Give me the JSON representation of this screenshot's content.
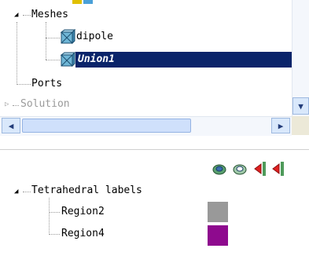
{
  "tree": {
    "meshes_label": "Meshes",
    "dipole_label": "dipole",
    "union_label": "Union1",
    "ports_label": "Ports",
    "solution_label": "Solution"
  },
  "icons": {
    "mesh": "mesh-cube-icon",
    "expanded": "triangle-down-icon",
    "collapsed": "triangle-right-icon"
  },
  "toolbar": {
    "buttons": [
      "mesh-show-icon",
      "mesh-hide-icon",
      "arrow-left-red-icon",
      "arrow-left-red-icon-2"
    ]
  },
  "labels_panel": {
    "group_label": "Tetrahedral labels",
    "regions": [
      {
        "label": "Region2",
        "color": "#999999"
      },
      {
        "label": "Region4",
        "color": "#8e0a8e"
      }
    ]
  },
  "colors": {
    "selection": "#0a246a",
    "scroll_button": "#d9e8fb"
  }
}
